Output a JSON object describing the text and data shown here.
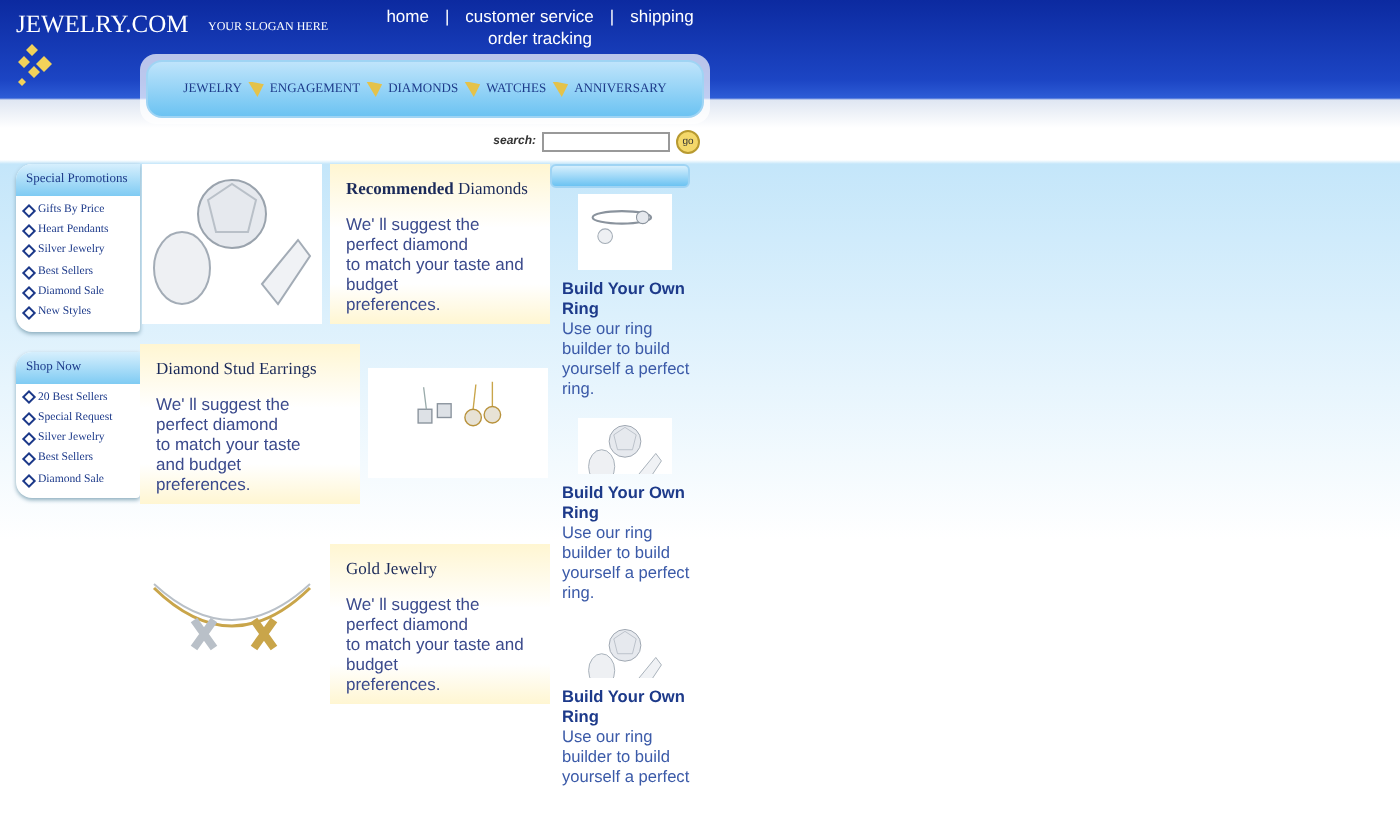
{
  "header": {
    "logo": "JEWELRY.COM",
    "slogan": "YOUR SLOGAN HERE",
    "links": [
      "home",
      "customer service",
      "shipping",
      "order tracking"
    ],
    "separator": "|"
  },
  "nav": [
    "JEWELRY",
    "ENGAGEMENT",
    "DIAMONDS",
    "WATCHES",
    "ANNIVERSARY"
  ],
  "search": {
    "label": "search:",
    "button": "go"
  },
  "sidebar": [
    {
      "title": "Special Promotions",
      "items": [
        "Gifts By Price",
        "Heart Pendants",
        "Silver Jewelry",
        "Best Sellers",
        "Diamond Sale",
        "New Styles"
      ]
    },
    {
      "title": "Shop Now",
      "items": [
        "20 Best Sellers",
        "Special Request",
        "Silver Jewelry",
        "Best Sellers",
        "Diamond Sale"
      ]
    }
  ],
  "features": [
    {
      "kind": "image-left",
      "title": "**Recommended** Diamonds",
      "text": "We'  ll suggest the\nperfect diamond\nto match your taste and\nbudget\npreferences."
    },
    {
      "kind": "text-left",
      "title": "Diamond Stud Earrings",
      "text": "We'  ll suggest the\nperfect diamond\nto match your taste\nand budget\npreferences."
    },
    {
      "kind": "image-left",
      "title": "Gold Jewelry",
      "text": "We'  ll suggest the\nperfect diamond\nto match your taste and\nbudget\npreferences."
    }
  ],
  "promos": [
    {
      "title": "Build Your Own Ring",
      "text": "Use our ring builder to build yourself a perfect ring."
    },
    {
      "title": "Build Your Own Ring",
      "text": "Use our ring builder to build yourself a perfect ring."
    },
    {
      "title": "Build Your Own Ring",
      "text": "Use our ring builder to build yourself a perfect"
    }
  ]
}
